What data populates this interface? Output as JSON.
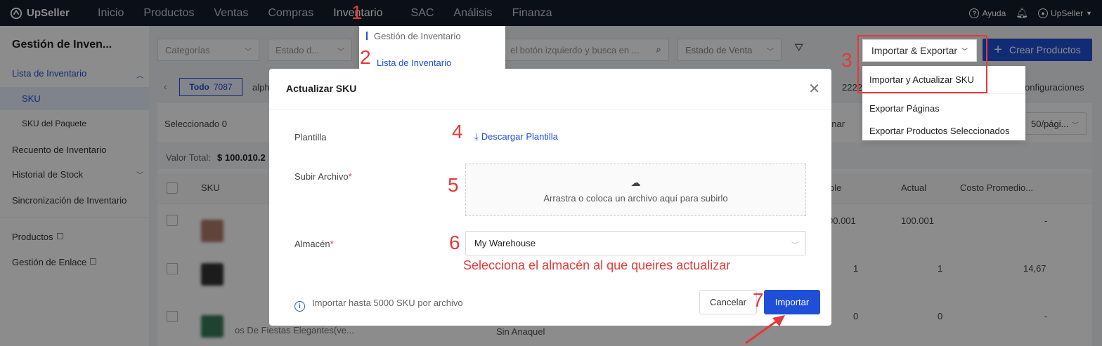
{
  "topnav": {
    "brand": "UpSeller",
    "items": [
      "Inicio",
      "Productos",
      "Ventas",
      "Compras",
      "Inventario",
      "SAC",
      "Análisis",
      "Finanza"
    ],
    "help": "Ayuda",
    "user": "UpSeller"
  },
  "inventario_menu": {
    "items": [
      "Gestión de Inventario",
      "Lista de Inventario"
    ]
  },
  "sidebar": {
    "title": "Gestión de Inven...",
    "items": [
      "Lista de Inventario",
      "SKU",
      "SKU del Paquete",
      "Recuento de Inventario",
      "Historial de Stock",
      "Sincronización de Inventario",
      "Productos",
      "Gestión de Enlace"
    ]
  },
  "filters": {
    "categorias": "Categorías",
    "estado": "Estado d...",
    "search_placeholder": "el botón izquierdo y busca en ...",
    "estado_venta": "Estado de Venta",
    "import_export": "Importar & Exportar",
    "crear": "Crear Productos"
  },
  "import_menu": {
    "items": [
      "Importar y Actualizar SKU",
      "Exportar Páginas",
      "Exportar Productos Seleccionados"
    ]
  },
  "background": {
    "tag_label": "Todo",
    "tag_count": "7087",
    "tab_text": "alph",
    "count_text": "2222",
    "config_text": "onfiguraciones",
    "selected_label": "Seleccionado",
    "selected_count": "0",
    "ordenar_text": "enar",
    "per_page": "50/pági...",
    "valor_label": "Valor Total:",
    "valor_value": "$ 100.010.2",
    "col_sku": "SKU",
    "col_disponible": "ble",
    "col_actual": "Actual",
    "col_costo": "Costo Promedio...",
    "rows": [
      {
        "disponible": "00.001",
        "actual": "100.001",
        "costo": "-"
      },
      {
        "disponible": "1",
        "actual": "1",
        "costo": "14,67"
      },
      {
        "disponible": "0",
        "actual": "0",
        "costo": "-",
        "name": "os De Fiestas Elegantes(ve...",
        "shelf": "Sin Anaquel"
      }
    ]
  },
  "modal": {
    "title": "Actualizar SKU",
    "plantilla_label": "Plantilla",
    "download_label": "Descargar Plantilla",
    "subir_label": "Subir Archivo",
    "upload_hint": "Arrastra o coloca un archivo aquí para subirlo",
    "almacen_label": "Almacén",
    "almacen_value": "My Warehouse",
    "info": "Importar hasta 5000 SKU por archivo",
    "cancel": "Cancelar",
    "import": "Importar"
  },
  "annotations": {
    "steps": [
      "1",
      "2",
      "3",
      "4",
      "5",
      "6",
      "7"
    ],
    "note": "Selecciona el almacén al que queires actualizar"
  },
  "colors": {
    "primary": "#1f4fd6",
    "annotation": "#e4393c",
    "nav_bg": "#141c2b"
  }
}
